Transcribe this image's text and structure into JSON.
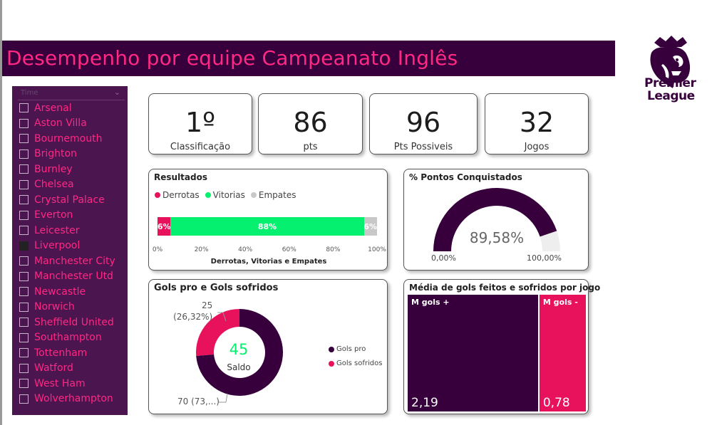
{
  "header": {
    "title": "Desempenho por equipe Campeanato Inglês"
  },
  "logo": {
    "line1": "Premier",
    "line2": "League"
  },
  "colors": {
    "purple": "#37003c",
    "pink": "#ff2882",
    "green": "#05f06e",
    "grey": "#c8c8c8",
    "slicer_bg": "#4b1550"
  },
  "slicer": {
    "header_label": "Time",
    "selected": "Liverpool",
    "items": [
      {
        "label": "Arsenal",
        "checked": false
      },
      {
        "label": "Aston Villa",
        "checked": false
      },
      {
        "label": "Bournemouth",
        "checked": false
      },
      {
        "label": "Brighton",
        "checked": false
      },
      {
        "label": "Burnley",
        "checked": false
      },
      {
        "label": "Chelsea",
        "checked": false
      },
      {
        "label": "Crystal Palace",
        "checked": false
      },
      {
        "label": "Everton",
        "checked": false
      },
      {
        "label": "Leicester",
        "checked": false
      },
      {
        "label": "Liverpool",
        "checked": true
      },
      {
        "label": "Manchester City",
        "checked": false
      },
      {
        "label": "Manchester Utd",
        "checked": false
      },
      {
        "label": "Newcastle",
        "checked": false
      },
      {
        "label": "Norwich",
        "checked": false
      },
      {
        "label": "Sheffield United",
        "checked": false
      },
      {
        "label": "Southampton",
        "checked": false
      },
      {
        "label": "Tottenham",
        "checked": false
      },
      {
        "label": "Watford",
        "checked": false
      },
      {
        "label": "West Ham",
        "checked": false
      },
      {
        "label": "Wolverhampton",
        "checked": false
      }
    ]
  },
  "kpis": [
    {
      "value": "1º",
      "label": "Classificação"
    },
    {
      "value": "86",
      "label": "pts"
    },
    {
      "value": "96",
      "label": "Pts Possiveis"
    },
    {
      "value": "32",
      "label": "Jogos"
    }
  ],
  "resultados": {
    "title": "Resultados",
    "legend": [
      "Derrotas",
      "Vitorias",
      "Empates"
    ],
    "axis_title": "Derrotas, Vitorias e Empates",
    "ticks": [
      "0%",
      "20%",
      "40%",
      "60%",
      "80%",
      "100%"
    ]
  },
  "gauge": {
    "title": "% Pontos Conquistados",
    "value_label": "89,58%",
    "min_label": "0,00%",
    "max_label": "100,00%"
  },
  "donut": {
    "title": "Gols pro e Gols sofridos",
    "center_value": "45",
    "center_label": "Saldo",
    "label_sofridos_line1": "25",
    "label_sofridos_line2": "(26,32%)",
    "label_pro": "70 (73,...)",
    "legend": [
      "Gols pro",
      "Gols sofridos"
    ]
  },
  "treemap": {
    "title": "Média de gols feitos e sofridos por jogo",
    "cells": [
      {
        "name": "M gols +",
        "value": "2,19"
      },
      {
        "name": "M gols -",
        "value": "0,78"
      }
    ]
  },
  "chart_data": [
    {
      "type": "bar",
      "title": "Resultados",
      "xlabel": "Derrotas, Vitorias e Empates",
      "xlim": [
        0,
        100
      ],
      "series": [
        {
          "name": "Derrotas",
          "values": [
            6
          ],
          "label": "6%"
        },
        {
          "name": "Vitorias",
          "values": [
            88
          ],
          "label": "88%"
        },
        {
          "name": "Empates",
          "values": [
            6
          ],
          "label": "6%"
        }
      ],
      "stacked": true,
      "orientation": "horizontal",
      "legend": "top-left"
    },
    {
      "type": "gauge",
      "title": "% Pontos Conquistados",
      "value": 89.58,
      "min": 0,
      "max": 100
    },
    {
      "type": "pie",
      "title": "Gols pro e Gols sofridos",
      "donut": true,
      "categories": [
        "Gols pro",
        "Gols sofridos"
      ],
      "values": [
        70,
        25
      ],
      "legend": "right"
    },
    {
      "type": "treemap",
      "title": "Média de gols feitos e sofridos por jogo",
      "categories": [
        "M gols +",
        "M gols -"
      ],
      "values": [
        2.19,
        0.78
      ]
    }
  ]
}
